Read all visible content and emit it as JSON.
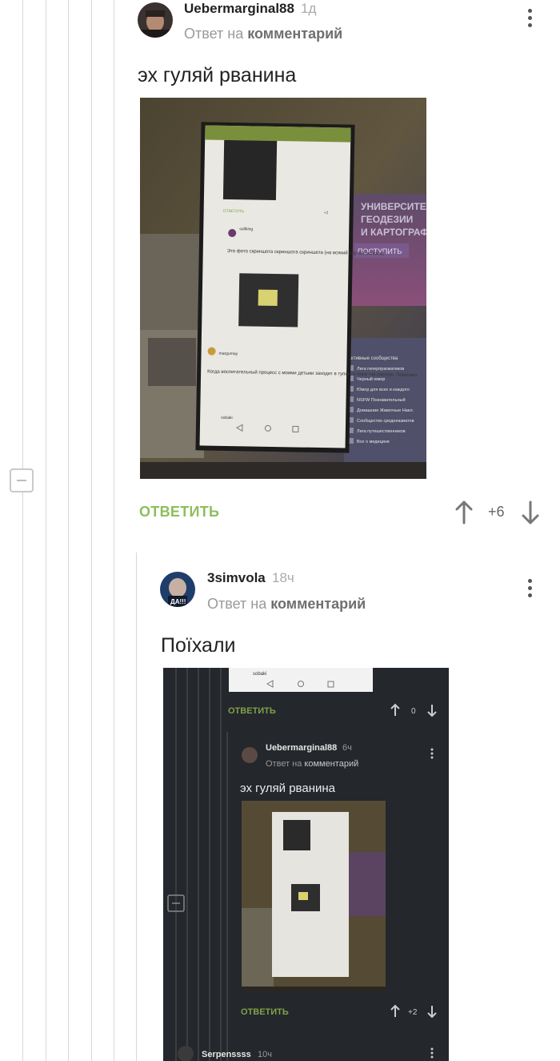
{
  "comment1": {
    "username": "Uebermarginal88",
    "time": "1д",
    "reply_prefix": "Ответ на",
    "reply_target": "комментарий",
    "text": "эх гуляй рванина",
    "reply_label": "ОТВЕТИТЬ",
    "rating": "+6"
  },
  "comment2": {
    "username": "3simvola",
    "time": "18ч",
    "reply_prefix": "Ответ на",
    "reply_target": "комментарий",
    "text": "Поїхали",
    "avatar_caption": "ДА!!!"
  },
  "photo1": {
    "inner_header": "Это фото скриншота скриншота скриншота (на всякий случай поясню)",
    "inner_text": "Когда воспитательный процесс с моими детьми заходит в тупик, я тоже так смотрю. Помогает.",
    "inner_user1": "sultking",
    "inner_user2": "margomay",
    "inner_user3": "sobaki",
    "inner_reply": "ОТВЕТИТЬ",
    "inner_rating": "+2",
    "banner1": "УНИВЕРСИТЕ",
    "banner2": "ГЕОДЕЗИИ",
    "banner3": "И КАРТОГРАФ",
    "banner_button": "ПОСТУПИТЬ",
    "side_title": "Активные сообщества",
    "side_items": [
      "Лига гиперпрагматиков",
      "Черный юмор",
      "Юмор для всех и каждого",
      "NSFW Познавательный",
      "Домашние Животные Накл.",
      "Сообщество среднеазиатов",
      "Лига путешественников",
      "Все о медицине"
    ]
  },
  "photo2": {
    "top_user": "sobaki",
    "reply_label": "ОТВЕТИТЬ",
    "rating_top": "0",
    "username": "Uebermarginal88",
    "time": "6ч",
    "reply_prefix": "Ответ на",
    "reply_target": "комментарий",
    "text": "эх гуляй рванина",
    "reply_label2": "ОТВЕТИТЬ",
    "rating": "+2",
    "bottom_user": "Serpenssss",
    "bottom_time": "10ч"
  },
  "colors": {
    "accent_green": "#8cbf5a",
    "thread_line": "#d8d8d8",
    "dark_bg": "#24272b"
  }
}
